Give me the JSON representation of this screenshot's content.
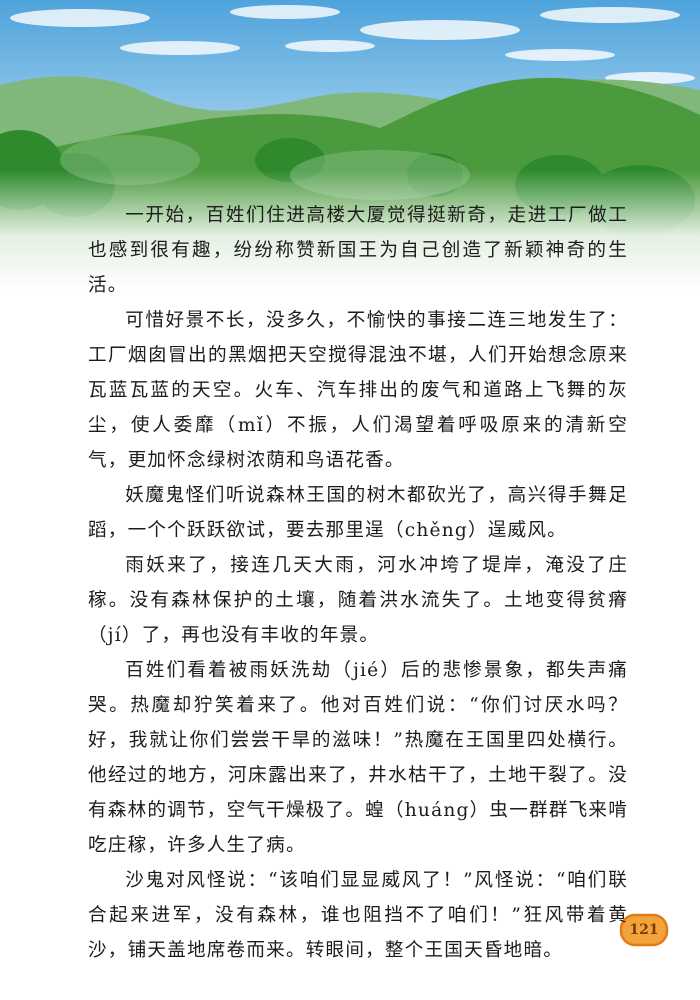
{
  "colors": {
    "sky_top": "#4ea3dc",
    "sky_bottom": "#d6ecf8",
    "mountain_far": "#7fb87a",
    "mountain_near": "#4c9a3e",
    "foliage_dark": "#2f8a2e",
    "ground_fade": "#ffffff",
    "page_badge_fill": "#f3a33b",
    "page_badge_border": "#e27b17"
  },
  "story": {
    "paragraphs": [
      "一开始，百姓们住进高楼大厦觉得挺新奇，走进工厂做工也感到很有趣，纷纷称赞新国王为自己创造了新颖神奇的生活。",
      "可惜好景不长，没多久，不愉快的事接二连三地发生了：工厂烟囱冒出的黑烟把天空搅得混浊不堪，人们开始想念原来瓦蓝瓦蓝的天空。火车、汽车排出的废气和道路上飞舞的灰尘，使人委靡（mǐ）不振，人们渴望着呼吸原来的清新空气，更加怀念绿树浓荫和鸟语花香。",
      "妖魔鬼怪们听说森林王国的树木都砍光了，高兴得手舞足蹈，一个个跃跃欲试，要去那里逞（chěng）逞威风。",
      "雨妖来了，接连几天大雨，河水冲垮了堤岸，淹没了庄稼。没有森林保护的土壤，随着洪水流失了。土地变得贫瘠（jí）了，再也没有丰收的年景。",
      "百姓们看着被雨妖洗劫（jié）后的悲惨景象，都失声痛哭。热魔却狞笑着来了。他对百姓们说：“你们讨厌水吗？好，我就让你们尝尝干旱的滋味！”热魔在王国里四处横行。他经过的地方，河床露出来了，井水枯干了，土地干裂了。没有森林的调节，空气干燥极了。蝗（huáng）虫一群群飞来啃吃庄稼，许多人生了病。",
      "沙鬼对风怪说：“该咱们显显威风了！”风怪说：“咱们联合起来进军，没有森林，谁也阻挡不了咱们！”狂风带着黄沙，铺天盖地席卷而来。转眼间，整个王国天昏地暗。"
    ]
  },
  "footer": {
    "page_number": "121"
  }
}
